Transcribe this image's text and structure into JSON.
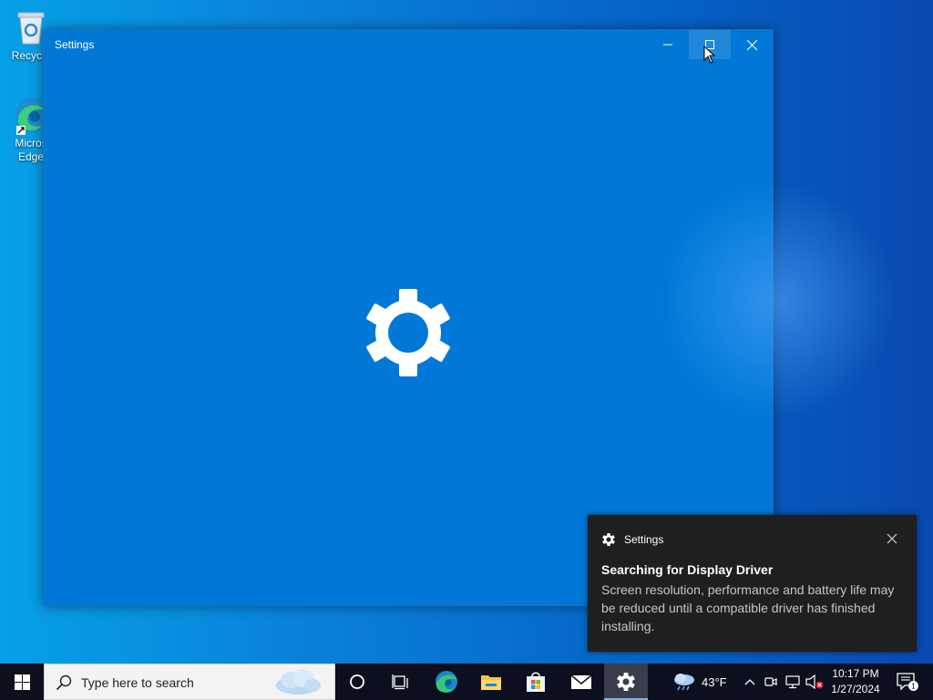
{
  "desktop": {
    "icons": [
      {
        "label_line1": "Recycle",
        "label_line2": "",
        "icon": "recycle-bin-icon"
      },
      {
        "label_line1": "Micros",
        "label_line2": "Edge",
        "icon": "edge-icon"
      }
    ]
  },
  "window": {
    "title": "Settings",
    "splash_icon": "gear-icon",
    "accent_color": "#0078d7"
  },
  "toast": {
    "app_name": "Settings",
    "app_icon": "gear-icon",
    "heading": "Searching for Display Driver",
    "body": "Screen resolution, performance and battery life may be reduced until a compatible driver has finished installing."
  },
  "taskbar": {
    "search_placeholder": "Type here to search",
    "pinned": [
      "cortana-icon",
      "task-view-icon",
      "edge-icon",
      "file-explorer-icon",
      "store-icon",
      "mail-icon",
      "settings-icon"
    ],
    "active_app": "settings-icon",
    "weather": {
      "temp": "43°F",
      "icon": "rain-cloud-icon"
    },
    "clock": {
      "time": "10:17 PM",
      "date": "1/27/2024"
    },
    "notification_count": "1"
  }
}
